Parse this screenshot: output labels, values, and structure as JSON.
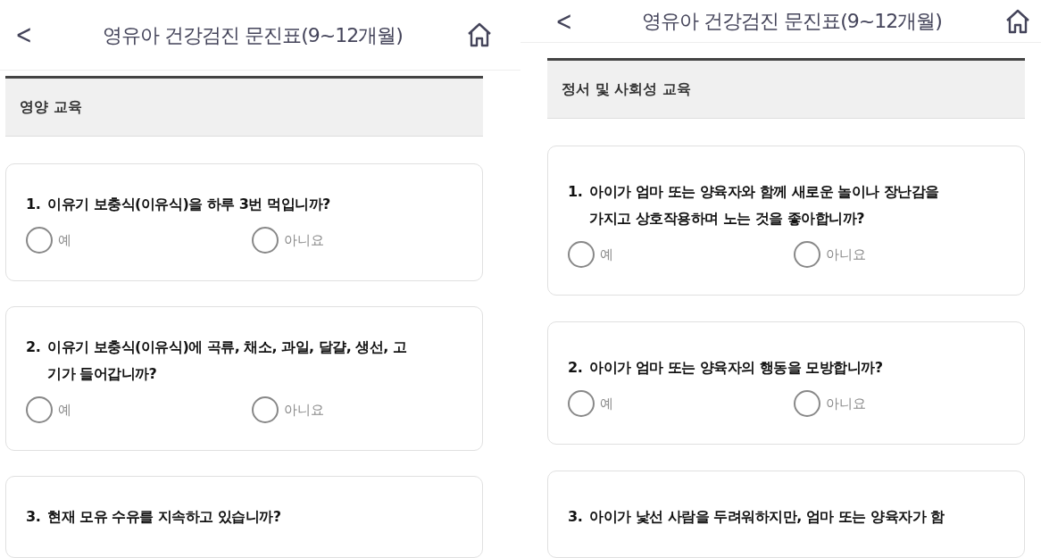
{
  "screens": [
    {
      "header": {
        "back": "<",
        "title": "영유아 건강검진 문진표(9~12개월)"
      },
      "section": {
        "title": "영양 교육"
      },
      "questions": [
        {
          "number": "1.",
          "text": "이유기 보충식(이유식)을 하루 3번 먹입니까?",
          "options": [
            {
              "label": "예",
              "selected": false
            },
            {
              "label": "아니요",
              "selected": false
            }
          ]
        },
        {
          "number": "2.",
          "text": "이유기 보충식(이유식)에 곡류, 채소, 과일, 달걀, 생선, 고기가 들어갑니까?",
          "options": [
            {
              "label": "예",
              "selected": false
            },
            {
              "label": "아니요",
              "selected": false
            }
          ]
        },
        {
          "number": "3.",
          "text": "현재 모유 수유를 지속하고 있습니까?"
        }
      ]
    },
    {
      "header": {
        "back": "<",
        "title": "영유아 건강검진 문진표(9~12개월)"
      },
      "section": {
        "title": "정서 및 사회성 교육"
      },
      "questions": [
        {
          "number": "1.",
          "text": "아이가 엄마 또는 양육자와 함께 새로운 놀이나 장난감을 가지고 상호작용하며 노는 것을 좋아합니까?",
          "options": [
            {
              "label": "예",
              "selected": false
            },
            {
              "label": "아니요",
              "selected": false
            }
          ]
        },
        {
          "number": "2.",
          "text": "아이가 엄마 또는 양육자의 행동을 모방합니까?",
          "options": [
            {
              "label": "예",
              "selected": false
            },
            {
              "label": "아니요",
              "selected": false
            }
          ]
        },
        {
          "number": "3.",
          "text": "아이가 낯선 사람을 두려워하지만, 엄마 또는 양육자가 함"
        }
      ]
    }
  ]
}
